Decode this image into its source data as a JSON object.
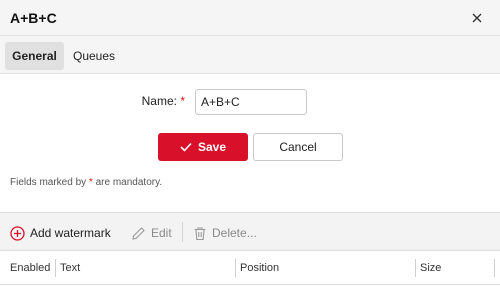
{
  "dialog": {
    "title": "A+B+C"
  },
  "tabs": [
    {
      "label": "General",
      "active": true
    },
    {
      "label": "Queues",
      "active": false
    }
  ],
  "form": {
    "name_label": "Name:",
    "required_marker": "*",
    "name_value": "A+B+C",
    "save_label": "Save",
    "cancel_label": "Cancel",
    "mandatory_prefix": "Fields marked by",
    "mandatory_star": "*",
    "mandatory_suffix": "are mandatory."
  },
  "toolbar": {
    "add_label": "Add watermark",
    "edit_label": "Edit",
    "delete_label": "Delete..."
  },
  "table": {
    "columns": [
      "Enabled",
      "Text",
      "Position",
      "Size"
    ]
  },
  "colors": {
    "accent": "#d8102a",
    "required": "#dd1111",
    "disabled_text": "#8a8a8a"
  },
  "icons": [
    "close-icon",
    "checkmark-icon",
    "add-circle-icon",
    "pencil-icon",
    "trash-icon"
  ]
}
